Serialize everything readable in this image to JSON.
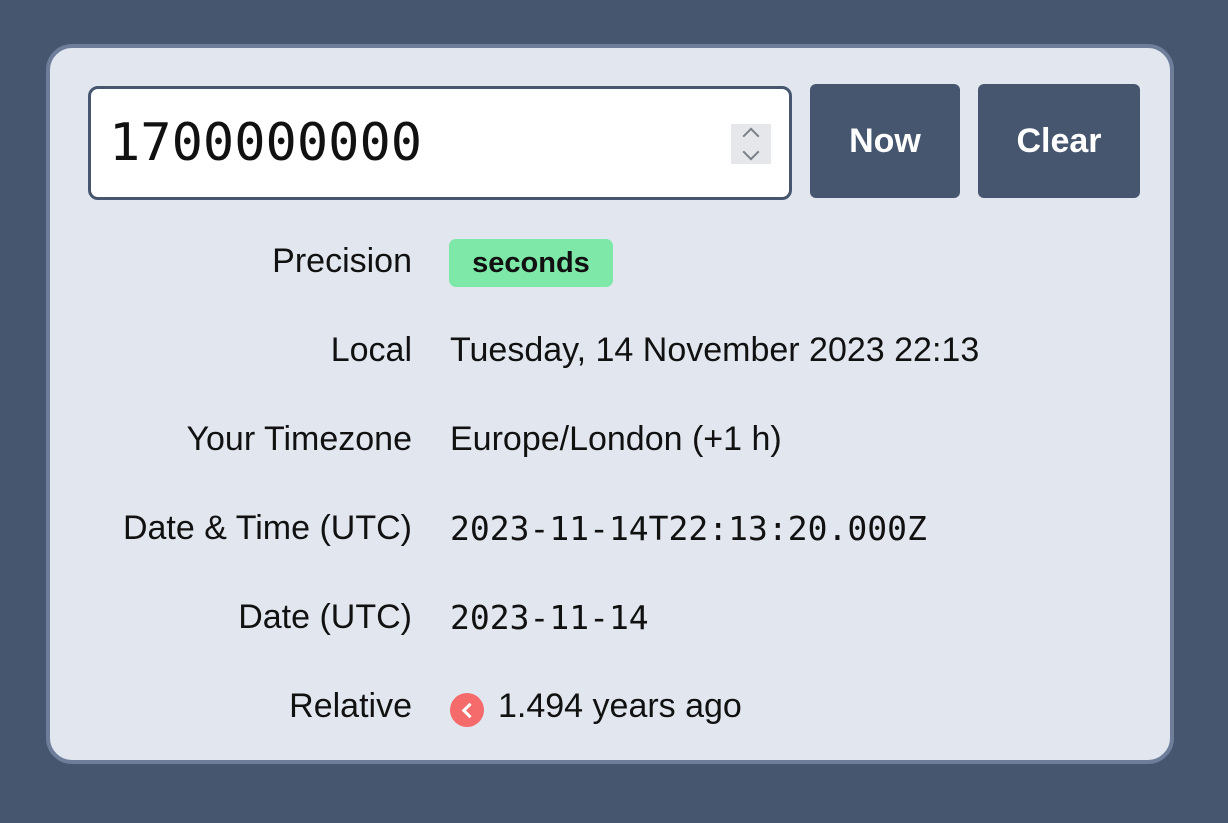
{
  "input": {
    "value": "1700000000"
  },
  "buttons": {
    "now": "Now",
    "clear": "Clear"
  },
  "rows": {
    "precision": {
      "label": "Precision",
      "value": "seconds"
    },
    "local": {
      "label": "Local",
      "value": "Tuesday, 14 November 2023 22:13"
    },
    "timezone": {
      "label": "Your Timezone",
      "value": "Europe/London (+1 h)"
    },
    "datetime_utc": {
      "label": "Date & Time (UTC)",
      "value": "2023-11-14T22:13:20.000Z"
    },
    "date_utc": {
      "label": "Date (UTC)",
      "value": "2023-11-14"
    },
    "relative": {
      "label": "Relative",
      "value": "1.494 years ago",
      "icon": "chevron-left-icon"
    }
  },
  "colors": {
    "background": "#46566e",
    "card": "#e2e7ef",
    "button": "#46566e",
    "badge": "#7ee8a8",
    "relative_icon": "#f56a6a"
  }
}
